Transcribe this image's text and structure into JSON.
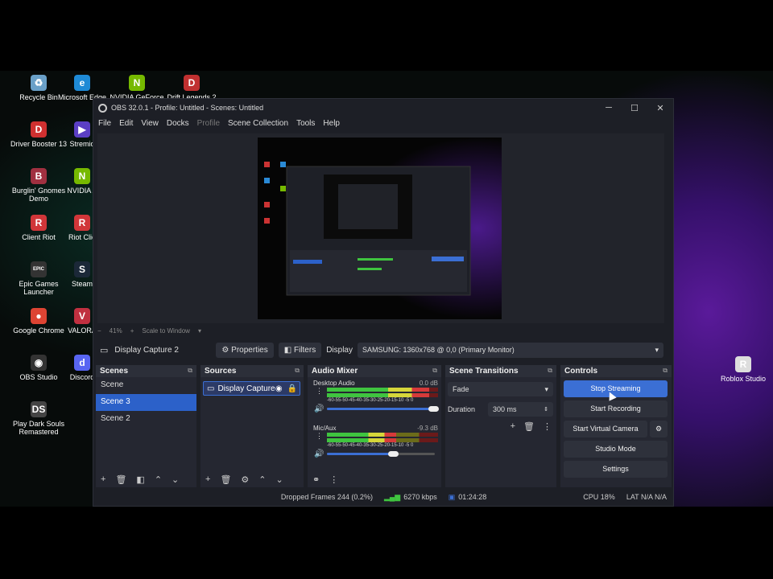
{
  "desktop": {
    "icons": [
      {
        "label": "Recycle Bin",
        "glyph": "♻",
        "color": "#6aa0c8"
      },
      {
        "label": "Microsoft Edge",
        "glyph": "e",
        "color": "#1e8ad6"
      },
      {
        "label": "NVIDIA GeForce",
        "glyph": "N",
        "color": "#76b900"
      },
      {
        "label": "Drift Legends 2",
        "glyph": "D",
        "color": "#c03030"
      },
      {
        "label": "Driver Booster 13",
        "glyph": "D",
        "color": "#d03030"
      },
      {
        "label": "Stremio",
        "glyph": "▶",
        "color": "#5b3fc4"
      },
      {
        "label": "Burglin' Gnomes Demo",
        "glyph": "B",
        "color": "#a03040"
      },
      {
        "label": "NVIDIA A",
        "glyph": "N",
        "color": "#76b900"
      },
      {
        "label": "Client Riot",
        "glyph": "R",
        "color": "#d13639"
      },
      {
        "label": "Riot Clie",
        "glyph": "R",
        "color": "#d13639"
      },
      {
        "label": "Epic Games Launcher",
        "glyph": "EPIC",
        "color": "#333"
      },
      {
        "label": "Steam",
        "glyph": "S",
        "color": "#1b2838"
      },
      {
        "label": "Google Chrome",
        "glyph": "●",
        "color": "#dd4433"
      },
      {
        "label": "VALORA",
        "glyph": "V",
        "color": "#c03040"
      },
      {
        "label": "OBS Studio",
        "glyph": "◉",
        "color": "#333"
      },
      {
        "label": "Discord",
        "glyph": "d",
        "color": "#5865f2"
      },
      {
        "label": "Play Dark Souls Remastered",
        "glyph": "DS",
        "color": "#444"
      },
      {
        "label": "Roblox Studio",
        "glyph": "R",
        "color": "#ddd"
      }
    ]
  },
  "obs": {
    "title": "OBS 32.0.1 - Profile: Untitled - Scenes: Untitled",
    "menu": [
      "File",
      "Edit",
      "View",
      "Docks",
      "Profile",
      "Scene Collection",
      "Tools",
      "Help"
    ],
    "zoom": {
      "minus": "−",
      "percent": "41%",
      "plus": "+",
      "scale_label": "Scale to Window"
    },
    "source_toolbar": {
      "source": "Display Capture 2",
      "properties": "Properties",
      "filters": "Filters",
      "display_label": "Display",
      "display_value": "SAMSUNG: 1360x768 @ 0,0 (Primary Monitor)"
    },
    "scenes": {
      "title": "Scenes",
      "items": [
        "Scene",
        "Scene 3",
        "Scene 2"
      ],
      "selected": 1
    },
    "sources": {
      "title": "Sources",
      "items": [
        "Display Capture"
      ]
    },
    "mixer": {
      "title": "Audio Mixer",
      "channels": [
        {
          "name": "Desktop Audio",
          "db": "0.0 dB",
          "level": 0.92,
          "volume": 0.99,
          "scale": "-60-55-50-45-40-35-30-25-20-15-10 -5 0"
        },
        {
          "name": "Mic/Aux",
          "db": "-9.3 dB",
          "level": 0.62,
          "volume": 0.62,
          "scale": "-60-55-50-45-40-35-30-25-20-15-10 -5 0"
        }
      ]
    },
    "transitions": {
      "title": "Scene Transitions",
      "value": "Fade",
      "duration_label": "Duration",
      "duration_value": "300 ms"
    },
    "controls": {
      "title": "Controls",
      "buttons": [
        "Stop Streaming",
        "Start Recording",
        "Start Virtual Camera",
        "Studio Mode",
        "Settings"
      ]
    },
    "status": {
      "dropped": "Dropped Frames 244 (0.2%)",
      "bitrate": "6270 kbps",
      "time": "01:24:28",
      "cpu": "CPU 18%",
      "lat": "LAT N/A N/A"
    }
  }
}
